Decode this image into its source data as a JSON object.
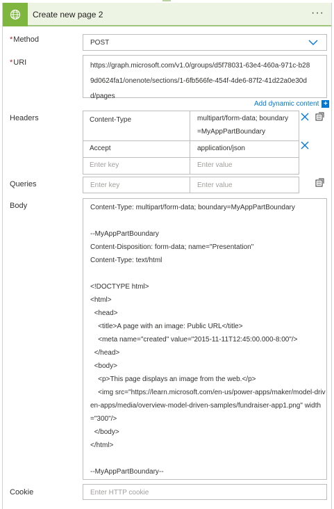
{
  "action": {
    "title": "Create new page 2",
    "more_label": "···"
  },
  "fields": {
    "method": {
      "label": "Method",
      "required_mark": "*",
      "value": "POST"
    },
    "uri": {
      "label": "URI",
      "required_mark": "*",
      "value": "https://graph.microsoft.com/v1.0/groups/d5f78031-63e4-460a-971c-b289d0624fa1/onenote/sections/1-6fb566fe-454f-4de6-87f2-41d22a0e30dd/pages"
    },
    "add_dynamic_content": "Add dynamic content",
    "headers": {
      "label": "Headers",
      "rows": [
        {
          "key": "Content-Type",
          "value": "multipart/form-data; boundary =MyAppPartBoundary"
        },
        {
          "key": "Accept",
          "value": "application/json"
        }
      ],
      "key_placeholder": "Enter key",
      "value_placeholder": "Enter value"
    },
    "queries": {
      "label": "Queries",
      "key_placeholder": "Enter key",
      "value_placeholder": "Enter value"
    },
    "body": {
      "label": "Body",
      "value": "Content-Type: multipart/form-data; boundary=MyAppPartBoundary\n\n--MyAppPartBoundary\nContent-Disposition: form-data; name=\"Presentation\"\nContent-Type: text/html\n\n<!DOCTYPE html>\n<html>\n  <head>\n    <title>A page with an image: Public URL</title>\n    <meta name=\"created\" value=\"2015-11-11T12:45:00.000-8:00\"/>\n  </head>\n  <body>\n    <p>This page displays an image from the web.</p>\n    <img src=\"https://learn.microsoft.com/en-us/power-apps/maker/model-driven-apps/media/overview-model-driven-samples/fundraiser-app1.png\" width=\"300\"/>\n  </body>\n</html>\n\n--MyAppPartBoundary--"
    },
    "cookie": {
      "label": "Cookie",
      "placeholder": "Enter HTTP cookie"
    }
  },
  "icons": {
    "action_icon": "globe-icon",
    "method_dropdown": "chevron-down-icon",
    "delete_row": "close-icon",
    "switch_mode": "switch-to-text-mode-icon"
  },
  "colors": {
    "header_bg": "#eef4e4",
    "icon_bg": "#7fb640",
    "accent_blue": "#0078d4",
    "required": "#a4262c"
  }
}
